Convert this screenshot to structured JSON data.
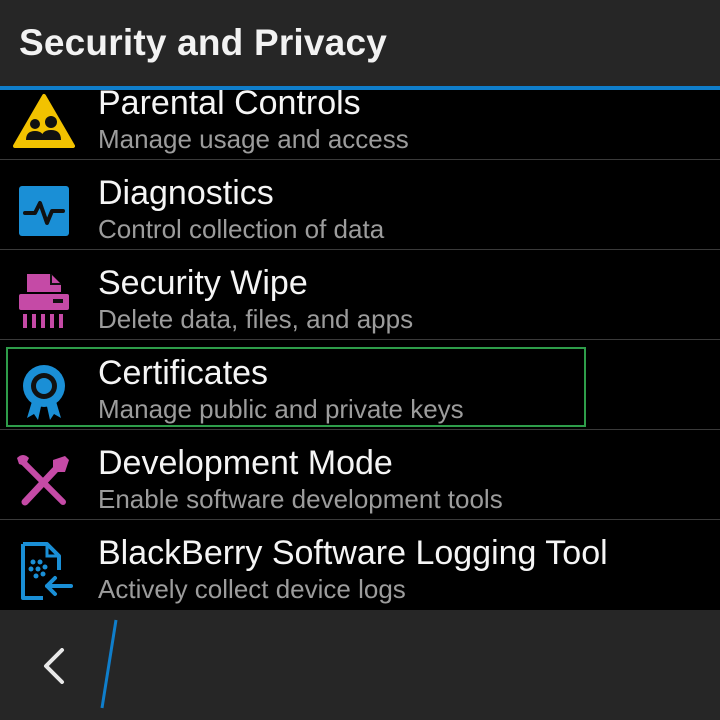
{
  "header": {
    "title": "Security and Privacy"
  },
  "items": [
    {
      "title": "Parental Controls",
      "subtitle": "Manage usage and access",
      "icon": "parental-controls-icon",
      "color": "#f2c200"
    },
    {
      "title": "Diagnostics",
      "subtitle": "Control collection of data",
      "icon": "diagnostics-icon",
      "color": "#1a8fd6"
    },
    {
      "title": "Security Wipe",
      "subtitle": "Delete data, files, and apps",
      "icon": "security-wipe-icon",
      "color": "#c54aa6"
    },
    {
      "title": "Certificates",
      "subtitle": "Manage public and private keys",
      "icon": "certificate-icon",
      "color": "#1a8fd6"
    },
    {
      "title": "Development Mode",
      "subtitle": "Enable software development tools",
      "icon": "tools-icon",
      "color": "#c54aa6"
    },
    {
      "title": "BlackBerry Software Logging Tool",
      "subtitle": "Actively collect device logs",
      "icon": "logging-tool-icon",
      "color": "#1a8fd6"
    }
  ],
  "action_bar": {
    "back_icon": "chevron-left-icon"
  },
  "colors": {
    "accent": "#0f7ecb",
    "highlight": "#2e9d4a",
    "background": "#000000",
    "bar": "#262626"
  }
}
